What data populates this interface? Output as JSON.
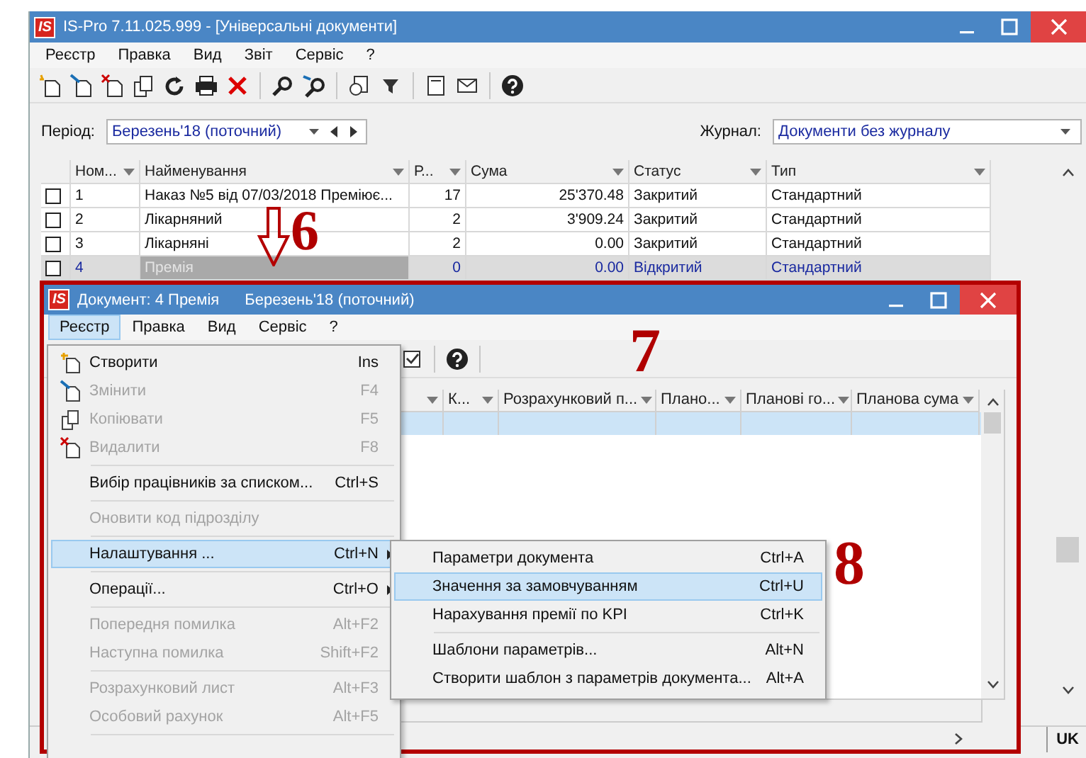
{
  "main_window": {
    "logo": "IS",
    "title": "IS-Pro 7.11.025.999 - [Універсальні документи]",
    "menu": [
      "Реєстр",
      "Правка",
      "Вид",
      "Звіт",
      "Сервіс",
      "?"
    ],
    "period": {
      "label": "Період:",
      "value": "Березень'18 (поточний)"
    },
    "journal": {
      "label": "Журнал:",
      "value": "Документи без журналу"
    },
    "table": {
      "columns": [
        {
          "label": "Ном...",
          "kind": "text"
        },
        {
          "label": "Найменування",
          "kind": "text"
        },
        {
          "label": "Р...",
          "kind": "number"
        },
        {
          "label": "Сума",
          "kind": "number"
        },
        {
          "label": "Статус",
          "kind": "text"
        },
        {
          "label": "Тип",
          "kind": "text"
        }
      ],
      "rows": [
        {
          "checked": false,
          "selected": false,
          "cells": [
            "1",
            "Наказ №5 від 07/03/2018 Преміює...",
            "17",
            "25'370.48",
            "Закритий",
            "Стандартний"
          ]
        },
        {
          "checked": false,
          "selected": false,
          "cells": [
            "2",
            "Лікарняний",
            "2",
            "3'909.24",
            "Закритий",
            "Стандартний"
          ]
        },
        {
          "checked": false,
          "selected": false,
          "cells": [
            "3",
            "Лікарняні",
            "2",
            "0.00",
            "Закритий",
            "Стандартний"
          ]
        },
        {
          "checked": false,
          "selected": true,
          "cells": [
            "4",
            "Премія",
            "0",
            "0.00",
            "Відкритий",
            "Стандартний"
          ]
        }
      ]
    },
    "status_bar": {
      "language": "UK"
    }
  },
  "document_window": {
    "logo": "IS",
    "title": "Документ: 4 Премія",
    "period": "Березень'18 (поточний)",
    "menu": [
      {
        "label": "Реєстр",
        "selected": true
      },
      {
        "label": "Правка",
        "selected": false
      },
      {
        "label": "Вид",
        "selected": false
      },
      {
        "label": "Сервіс",
        "selected": false
      },
      {
        "label": "?",
        "selected": false
      }
    ],
    "table": {
      "columns": [
        "К...",
        "Розрахунковий п...",
        "Плано...",
        "Планові го...",
        "Планова сума"
      ],
      "rows": [
        {
          "selected": true
        }
      ]
    }
  },
  "dropdown_menu": {
    "items": [
      {
        "kind": "item",
        "label": "Створити",
        "shortcut": "Ins",
        "disabled": false,
        "selected": false
      },
      {
        "kind": "item",
        "label": "Змінити",
        "shortcut": "F4",
        "disabled": true,
        "selected": false
      },
      {
        "kind": "item",
        "label": "Копіювати",
        "shortcut": "F5",
        "disabled": true,
        "selected": false
      },
      {
        "kind": "item",
        "label": "Видалити",
        "shortcut": "F8",
        "disabled": true,
        "selected": false
      },
      {
        "kind": "separator"
      },
      {
        "kind": "item",
        "label": "Вибір працівників за списком...",
        "shortcut": "Ctrl+S",
        "disabled": false,
        "selected": false
      },
      {
        "kind": "separator"
      },
      {
        "kind": "item",
        "label": "Оновити код підрозділу",
        "disabled": true,
        "selected": false
      },
      {
        "kind": "separator"
      },
      {
        "kind": "item",
        "label": "Налаштування ...",
        "shortcut": "Ctrl+N",
        "disabled": false,
        "selected": true,
        "submenu": true
      },
      {
        "kind": "separator"
      },
      {
        "kind": "item",
        "label": "Операції...",
        "shortcut": "Ctrl+O",
        "disabled": false,
        "selected": false,
        "submenu": true
      },
      {
        "kind": "separator"
      },
      {
        "kind": "item",
        "label": "Попередня помилка",
        "shortcut": "Alt+F2",
        "disabled": true,
        "selected": false
      },
      {
        "kind": "item",
        "label": "Наступна помилка",
        "shortcut": "Shift+F2",
        "disabled": true,
        "selected": false
      },
      {
        "kind": "separator"
      },
      {
        "kind": "item",
        "label": "Розрахунковий лист",
        "shortcut": "Alt+F3",
        "disabled": true,
        "selected": false
      },
      {
        "kind": "item",
        "label": "Особовий рахунок",
        "shortcut": "Alt+F5",
        "disabled": true,
        "selected": false
      },
      {
        "kind": "separator"
      }
    ]
  },
  "submenu": {
    "items": [
      {
        "kind": "item",
        "label": "Параметри документа",
        "shortcut": "Ctrl+A",
        "selected": false
      },
      {
        "kind": "item",
        "label": "Значення за замовчуванням",
        "shortcut": "Ctrl+U",
        "selected": true
      },
      {
        "kind": "item",
        "label": "Нарахування премії по KPI",
        "shortcut": "Ctrl+K",
        "selected": false
      },
      {
        "kind": "separator"
      },
      {
        "kind": "item",
        "label": "Шаблони параметрів...",
        "shortcut": "Alt+N",
        "selected": false
      },
      {
        "kind": "item",
        "label": "Створити шаблон з параметрів документа...",
        "shortcut": "Alt+A",
        "selected": false
      }
    ]
  },
  "annotations": [
    {
      "kind": "arrow",
      "label": "6"
    },
    {
      "kind": "plain",
      "label": "7"
    },
    {
      "kind": "plain",
      "label": "8"
    }
  ]
}
